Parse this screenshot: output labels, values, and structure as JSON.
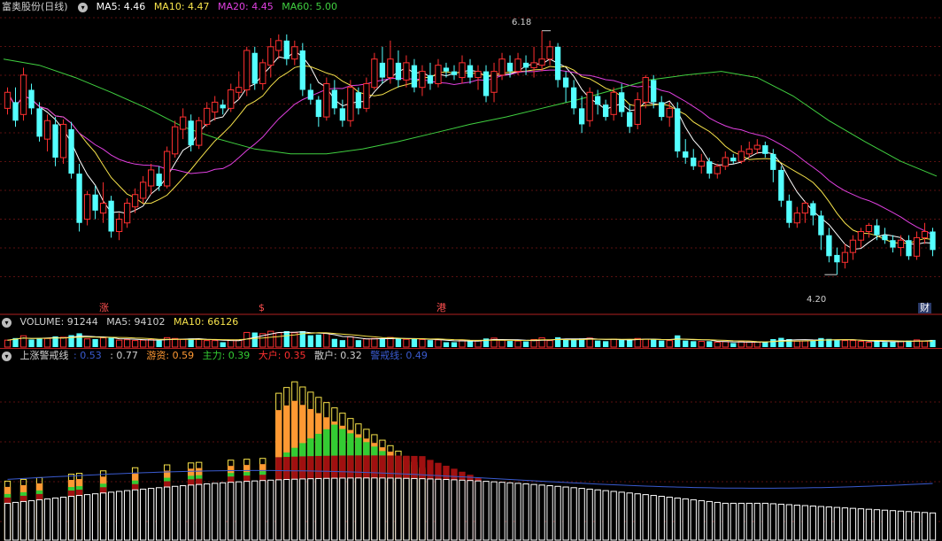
{
  "stock": {
    "title": "富奥股份(日线)"
  },
  "price_panel": {
    "ma_labels": [
      {
        "text": "MA5: 4.46",
        "color": "#ffffff"
      },
      {
        "text": "MA10: 4.47",
        "color": "#f7e34b"
      },
      {
        "text": "MA20: 4.45",
        "color": "#e040e0"
      },
      {
        "text": "MA60: 5.00",
        "color": "#40d040"
      }
    ],
    "high_label": "6.18",
    "low_label": "4.20",
    "events": [
      {
        "text": "涨",
        "color": "#ff5050"
      },
      {
        "text": "$",
        "color": "#ff5050"
      },
      {
        "text": "港",
        "color": "#ff5050"
      },
      {
        "text": "财",
        "color": "#ffffff"
      }
    ]
  },
  "volume_panel": {
    "labels": [
      {
        "text": "VOLUME: 91244",
        "color": "#d0d0d0"
      },
      {
        "text": "MA5: 94102",
        "color": "#d0d0d0"
      },
      {
        "text": "MA10: 66126",
        "color": "#f7e34b"
      }
    ]
  },
  "indicator_panel": {
    "name": "上涨警戒线",
    "labels": [
      {
        "text": ": 0.53",
        "color": "#3a5bd0"
      },
      {
        "text": ": 0.77",
        "color": "#d0d0d0"
      },
      {
        "text": "游资: 0.59",
        "color": "#ff9933"
      },
      {
        "text": "主力: 0.39",
        "color": "#33cc33"
      },
      {
        "text": "大户: 0.35",
        "color": "#ff3030"
      },
      {
        "text": "散户: 0.32",
        "color": "#d0d0d0"
      },
      {
        "text": "警戒线: 0.49",
        "color": "#3a5bd0"
      }
    ]
  },
  "chart_data": {
    "type": "candlestick",
    "price_range": [
      4.0,
      6.3
    ],
    "up_color": "#ff3030",
    "down_color": "#54ffff",
    "ma_colors": {
      "ma5": "#ffffff",
      "ma10": "#f7e34b",
      "ma20": "#e040e0",
      "ma60": "#40d040"
    },
    "candles": [
      [
        5.55,
        5.68,
        5.5,
        5.72
      ],
      [
        5.6,
        5.45,
        5.4,
        5.72
      ],
      [
        5.5,
        5.82,
        5.45,
        5.88
      ],
      [
        5.7,
        5.55,
        5.5,
        5.75
      ],
      [
        5.55,
        5.32,
        5.28,
        5.6
      ],
      [
        5.3,
        5.45,
        5.2,
        5.5
      ],
      [
        5.42,
        5.15,
        5.08,
        5.48
      ],
      [
        5.15,
        5.42,
        5.1,
        5.46
      ],
      [
        5.38,
        5.02,
        4.98,
        5.44
      ],
      [
        5.02,
        4.62,
        4.55,
        5.1
      ],
      [
        4.65,
        4.85,
        4.6,
        4.88
      ],
      [
        4.85,
        4.72,
        4.65,
        4.92
      ],
      [
        4.7,
        4.78,
        4.62,
        4.95
      ],
      [
        4.8,
        4.55,
        4.5,
        4.84
      ],
      [
        4.55,
        4.65,
        4.48,
        4.7
      ],
      [
        4.62,
        4.78,
        4.58,
        4.82
      ],
      [
        4.75,
        4.85,
        4.7,
        4.9
      ],
      [
        4.82,
        4.95,
        4.78,
        5.0
      ],
      [
        4.92,
        5.05,
        4.85,
        5.1
      ],
      [
        5.02,
        4.92,
        4.88,
        5.08
      ],
      [
        4.92,
        5.2,
        4.9,
        5.24
      ],
      [
        5.18,
        5.4,
        5.15,
        5.45
      ],
      [
        5.38,
        5.48,
        5.3,
        5.55
      ],
      [
        5.45,
        5.25,
        5.2,
        5.5
      ],
      [
        5.25,
        5.45,
        5.22,
        5.48
      ],
      [
        5.42,
        5.55,
        5.4,
        5.6
      ],
      [
        5.52,
        5.6,
        5.45,
        5.65
      ],
      [
        5.58,
        5.55,
        5.5,
        5.62
      ],
      [
        5.55,
        5.7,
        5.52,
        5.75
      ],
      [
        5.68,
        5.72,
        5.62,
        5.85
      ],
      [
        5.7,
        6.02,
        5.65,
        6.05
      ],
      [
        6.0,
        5.75,
        5.7,
        6.05
      ],
      [
        5.75,
        5.92,
        5.7,
        5.95
      ],
      [
        5.9,
        6.05,
        5.8,
        6.12
      ],
      [
        6.02,
        6.1,
        5.95,
        6.15
      ],
      [
        6.1,
        5.95,
        5.9,
        6.15
      ],
      [
        5.95,
        6.05,
        5.9,
        6.1
      ],
      [
        6.02,
        5.7,
        5.65,
        6.08
      ],
      [
        5.7,
        5.62,
        5.58,
        5.75
      ],
      [
        5.62,
        5.48,
        5.4,
        5.65
      ],
      [
        5.48,
        5.75,
        5.45,
        5.8
      ],
      [
        5.7,
        5.55,
        5.5,
        5.78
      ],
      [
        5.55,
        5.45,
        5.4,
        5.62
      ],
      [
        5.45,
        5.72,
        5.4,
        5.78
      ],
      [
        5.68,
        5.55,
        5.5,
        5.72
      ],
      [
        5.55,
        5.75,
        5.52,
        5.8
      ],
      [
        5.72,
        5.95,
        5.7,
        6.0
      ],
      [
        5.92,
        5.8,
        5.75,
        6.05
      ],
      [
        5.8,
        5.95,
        5.75,
        6.1
      ],
      [
        5.92,
        5.78,
        5.72,
        6.02
      ],
      [
        5.78,
        5.92,
        5.72,
        5.98
      ],
      [
        5.9,
        5.72,
        5.68,
        5.95
      ],
      [
        5.72,
        5.85,
        5.65,
        5.9
      ],
      [
        5.82,
        5.75,
        5.7,
        5.92
      ],
      [
        5.75,
        5.9,
        5.72,
        5.95
      ],
      [
        5.88,
        5.85,
        5.8,
        5.92
      ],
      [
        5.85,
        5.82,
        5.78,
        5.9
      ],
      [
        5.8,
        5.92,
        5.75,
        5.98
      ],
      [
        5.9,
        5.8,
        5.75,
        5.95
      ],
      [
        5.8,
        5.85,
        5.7,
        5.9
      ],
      [
        5.85,
        5.65,
        5.6,
        5.9
      ],
      [
        5.68,
        5.85,
        5.6,
        5.92
      ],
      [
        5.82,
        5.95,
        5.78,
        6.0
      ],
      [
        5.92,
        5.85,
        5.8,
        5.98
      ],
      [
        5.85,
        5.95,
        5.82,
        6.0
      ],
      [
        5.92,
        5.88,
        5.82,
        5.98
      ],
      [
        5.88,
        5.92,
        5.8,
        6.05
      ],
      [
        5.9,
        5.95,
        5.85,
        6.18
      ],
      [
        5.95,
        6.05,
        5.9,
        6.1
      ],
      [
        6.05,
        5.78,
        5.72,
        6.08
      ],
      [
        5.8,
        5.72,
        5.6,
        5.85
      ],
      [
        5.72,
        5.55,
        5.5,
        5.78
      ],
      [
        5.55,
        5.42,
        5.35,
        5.65
      ],
      [
        5.45,
        5.68,
        5.4,
        5.72
      ],
      [
        5.65,
        5.58,
        5.5,
        5.7
      ],
      [
        5.58,
        5.48,
        5.45,
        5.62
      ],
      [
        5.5,
        5.68,
        5.45,
        5.72
      ],
      [
        5.68,
        5.52,
        5.48,
        5.75
      ],
      [
        5.52,
        5.4,
        5.35,
        5.58
      ],
      [
        5.42,
        5.62,
        5.38,
        5.68
      ],
      [
        5.6,
        5.8,
        5.55,
        5.82
      ],
      [
        5.78,
        5.6,
        5.55,
        5.82
      ],
      [
        5.6,
        5.48,
        5.45,
        5.65
      ],
      [
        5.48,
        5.55,
        5.4,
        5.6
      ],
      [
        5.55,
        5.2,
        5.15,
        5.6
      ],
      [
        5.2,
        5.15,
        5.1,
        5.3
      ],
      [
        5.15,
        5.08,
        5.05,
        5.22
      ],
      [
        5.08,
        5.12,
        5.02,
        5.18
      ],
      [
        5.12,
        5.02,
        4.98,
        5.15
      ],
      [
        5.02,
        5.08,
        4.98,
        5.1
      ],
      [
        5.08,
        5.15,
        5.05,
        5.2
      ],
      [
        5.15,
        5.12,
        5.1,
        5.18
      ],
      [
        5.12,
        5.2,
        5.1,
        5.25
      ],
      [
        5.18,
        5.22,
        5.15,
        5.28
      ],
      [
        5.22,
        5.25,
        5.18,
        5.3
      ],
      [
        5.25,
        5.18,
        5.15,
        5.28
      ],
      [
        5.18,
        5.05,
        4.95,
        5.22
      ],
      [
        5.05,
        4.8,
        4.75,
        5.08
      ],
      [
        4.8,
        4.62,
        4.58,
        4.85
      ],
      [
        4.62,
        4.7,
        4.58,
        4.75
      ],
      [
        4.7,
        4.78,
        4.62,
        4.8
      ],
      [
        4.78,
        4.68,
        4.6,
        4.8
      ],
      [
        4.68,
        4.52,
        4.4,
        4.72
      ],
      [
        4.52,
        4.35,
        4.3,
        4.58
      ],
      [
        4.36,
        4.3,
        4.2,
        4.42
      ],
      [
        4.3,
        4.38,
        4.25,
        4.45
      ],
      [
        4.38,
        4.48,
        4.32,
        4.52
      ],
      [
        4.48,
        4.55,
        4.42,
        4.58
      ],
      [
        4.55,
        4.6,
        4.5,
        4.62
      ],
      [
        4.6,
        4.52,
        4.48,
        4.65
      ],
      [
        4.52,
        4.48,
        4.45,
        4.58
      ],
      [
        4.48,
        4.42,
        4.38,
        4.52
      ],
      [
        4.42,
        4.48,
        4.35,
        4.52
      ],
      [
        4.48,
        4.35,
        4.32,
        4.52
      ],
      [
        4.35,
        4.5,
        4.32,
        4.55
      ],
      [
        4.5,
        4.55,
        4.45,
        4.62
      ],
      [
        4.55,
        4.4,
        4.35,
        4.58
      ]
    ],
    "ma60_points": [
      5.95,
      5.9,
      5.8,
      5.68,
      5.55,
      5.4,
      5.3,
      5.22,
      5.18,
      5.18,
      5.22,
      5.28,
      5.35,
      5.42,
      5.48,
      5.55,
      5.62,
      5.7,
      5.78,
      5.82,
      5.85,
      5.8,
      5.65,
      5.45,
      5.28,
      5.12,
      5.0
    ]
  }
}
